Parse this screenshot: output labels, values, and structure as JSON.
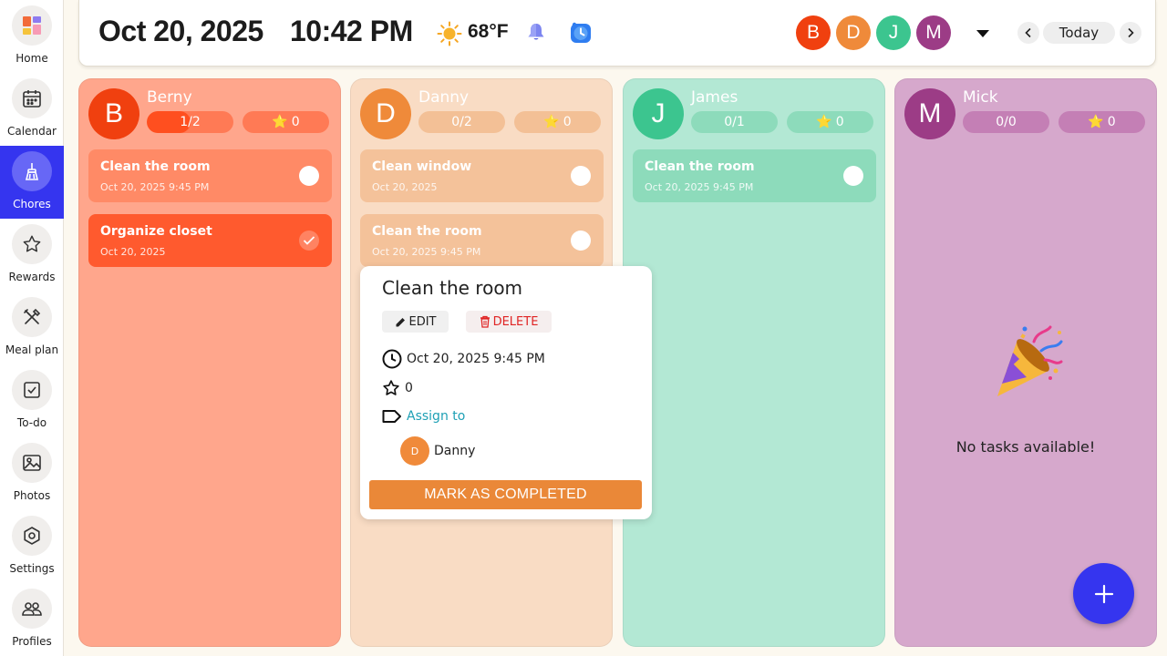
{
  "sidebar": {
    "items": [
      {
        "label": "Home",
        "icon": "home-grid-icon"
      },
      {
        "label": "Calendar",
        "icon": "calendar-icon"
      },
      {
        "label": "Chores",
        "icon": "broom-icon",
        "active": true
      },
      {
        "label": "Rewards",
        "icon": "star-icon"
      },
      {
        "label": "Meal plan",
        "icon": "utensils-icon"
      },
      {
        "label": "To-do",
        "icon": "checkbox-icon"
      },
      {
        "label": "Photos",
        "icon": "photo-icon"
      },
      {
        "label": "Settings",
        "icon": "gear-icon"
      },
      {
        "label": "Profiles",
        "icon": "people-icon"
      }
    ]
  },
  "header": {
    "date": "Oct 20, 2025",
    "time": "10:42 PM",
    "temperature": "68°F",
    "weather_icon": "sun-icon",
    "avatars": [
      {
        "initial": "B",
        "color": "#f0400f"
      },
      {
        "initial": "D",
        "color": "#ef8a3a"
      },
      {
        "initial": "J",
        "color": "#3cc58f"
      },
      {
        "initial": "M",
        "color": "#9c3c86"
      }
    ],
    "today_label": "Today"
  },
  "columns": [
    {
      "name": "Berny",
      "initial": "B",
      "avatar_color": "#f0400f",
      "bg_color": "#ffa68c",
      "task_color": "#ff8a66",
      "done_color": "#ff5a2e",
      "pill_color": "#ff7a55",
      "fill_color": "#ff4f1f",
      "progress": "1/2",
      "progress_fraction": 0.5,
      "points": "0",
      "tasks": [
        {
          "title": "Clean the room",
          "date": "Oct 20, 2025 9:45 PM",
          "done": false
        },
        {
          "title": "Organize closet",
          "date": "Oct 20, 2025",
          "done": true
        }
      ]
    },
    {
      "name": "Danny",
      "initial": "D",
      "avatar_color": "#ef8a3a",
      "bg_color": "#f9dcc4",
      "task_color": "#f4c29a",
      "done_color": "#f0a060",
      "pill_color": "#f3c096",
      "fill_color": "#ef8a3a",
      "progress": "0/2",
      "progress_fraction": 0,
      "points": "0",
      "tasks": [
        {
          "title": "Clean window",
          "date": "Oct 20, 2025",
          "done": false
        },
        {
          "title": "Clean the room",
          "date": "Oct 20, 2025 9:45 PM",
          "done": false
        }
      ]
    },
    {
      "name": "James",
      "initial": "J",
      "avatar_color": "#3cc58f",
      "bg_color": "#b3e8d4",
      "task_color": "#8ddbbb",
      "done_color": "#3cc58f",
      "pill_color": "#8ddbbb",
      "fill_color": "#3cc58f",
      "progress": "0/1",
      "progress_fraction": 0,
      "points": "0",
      "tasks": [
        {
          "title": "Clean the room",
          "date": "Oct 20, 2025 9:45 PM",
          "done": false
        }
      ]
    },
    {
      "name": "Mick",
      "initial": "M",
      "avatar_color": "#9c3c86",
      "bg_color": "#d6a8cc",
      "task_color": "#c47fb5",
      "done_color": "#9c3c86",
      "pill_color": "#c47fb5",
      "fill_color": "#9c3c86",
      "progress": "0/0",
      "progress_fraction": 0,
      "points": "0",
      "tasks": [],
      "empty_text": "No tasks available!"
    }
  ],
  "popup": {
    "title": "Clean the room",
    "edit_label": "EDIT",
    "delete_label": "DELETE",
    "datetime": "Oct 20, 2025 9:45 PM",
    "points": "0",
    "assign_label": "Assign to",
    "assignee_initial": "D",
    "assignee_name": "Danny",
    "complete_label": "MARK AS COMPLETED"
  },
  "colors": {
    "accent": "#3535ef",
    "complete_button": "#ea8838",
    "delete_text": "#e02424",
    "assign_link": "#1ea0b5"
  }
}
